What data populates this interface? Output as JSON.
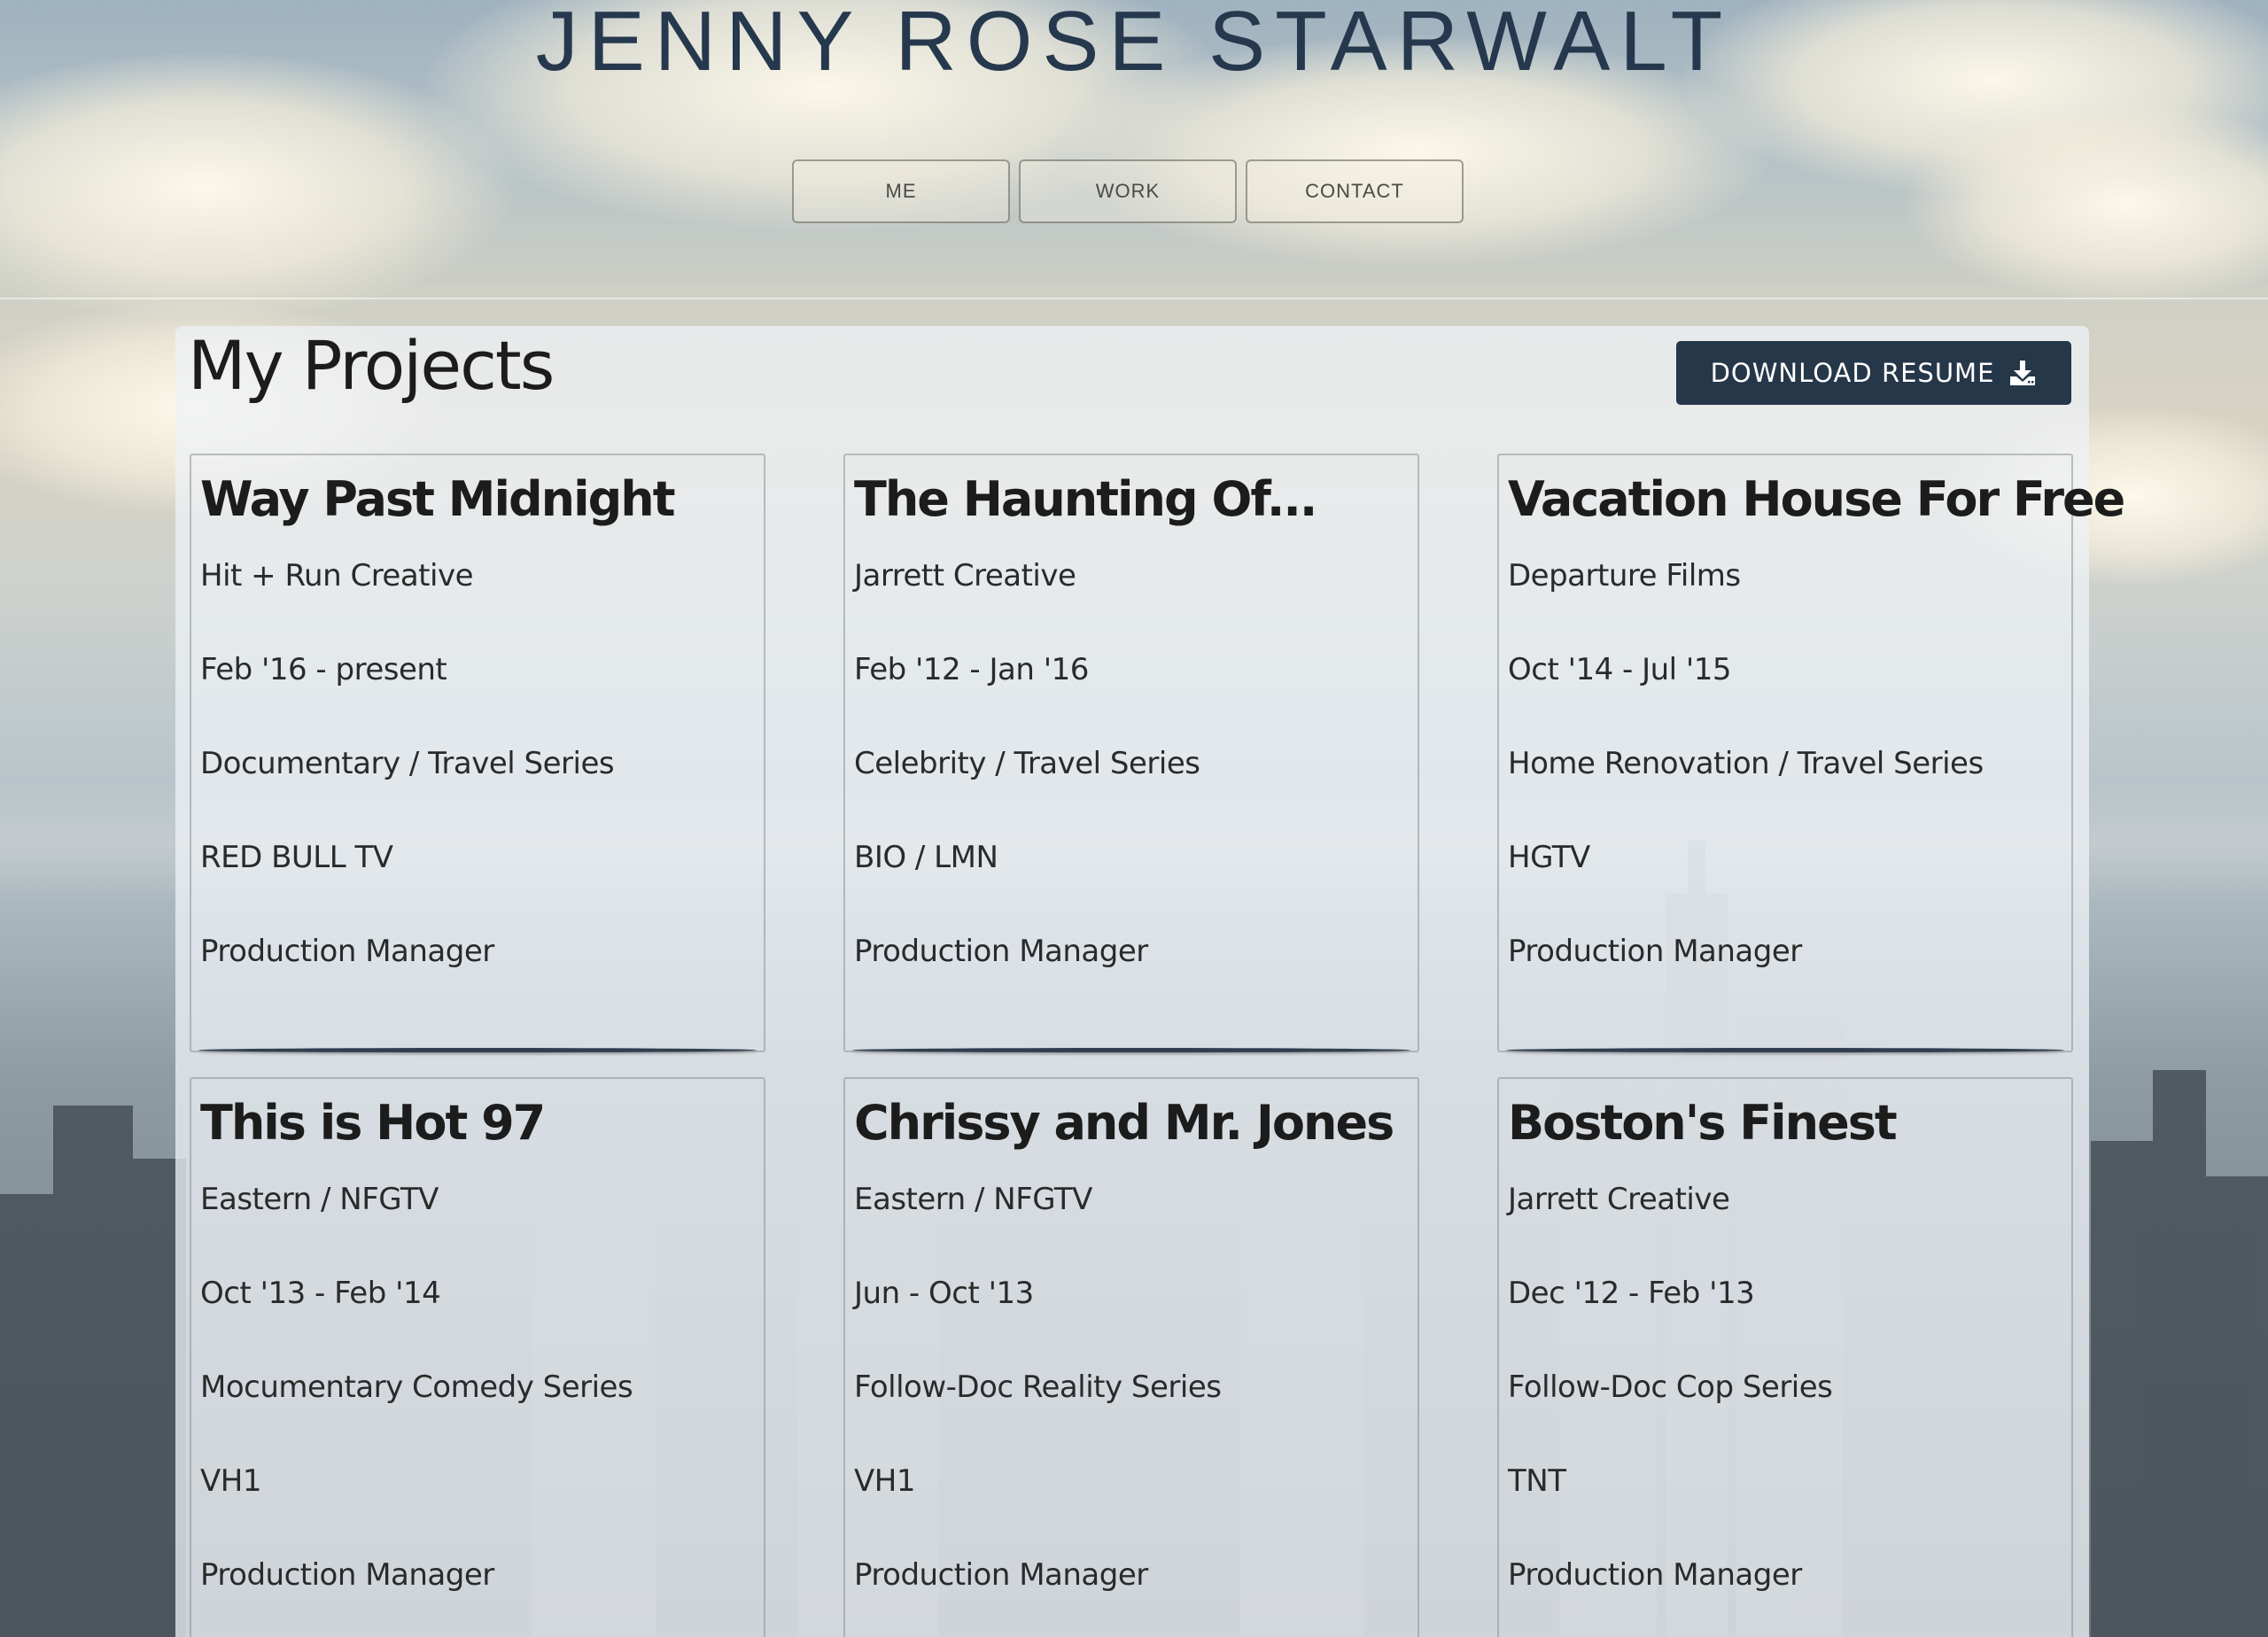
{
  "header": {
    "title": "JENNY ROSE STARWALT"
  },
  "nav": {
    "items": [
      {
        "label": "ME"
      },
      {
        "label": "WORK"
      },
      {
        "label": "CONTACT"
      }
    ]
  },
  "main": {
    "heading": "My Projects",
    "download_label": "DOWNLOAD RESUME",
    "download_icon": "download-icon"
  },
  "projects": [
    {
      "title": "Way Past Midnight",
      "company": "Hit + Run Creative",
      "dates": "Feb '16 - present",
      "genre": "Documentary / Travel Series",
      "network": "RED BULL TV",
      "role": "Production Manager"
    },
    {
      "title": "The Haunting Of...",
      "company": "Jarrett Creative",
      "dates": "Feb '12 - Jan '16",
      "genre": "Celebrity / Travel Series",
      "network": "BIO / LMN",
      "role": "Production Manager"
    },
    {
      "title": "Vacation House For Free",
      "company": "Departure Films",
      "dates": "Oct '14 - Jul '15",
      "genre": "Home Renovation / Travel Series",
      "network": "HGTV",
      "role": "Production Manager"
    },
    {
      "title": "This is Hot 97",
      "company": "Eastern / NFGTV",
      "dates": "Oct '13 - Feb '14",
      "genre": "Mocumentary Comedy Series",
      "network": "VH1",
      "role": "Production Manager"
    },
    {
      "title": "Chrissy and Mr. Jones",
      "company": "Eastern / NFGTV",
      "dates": "Jun - Oct '13",
      "genre": "Follow-Doc Reality Series",
      "network": "VH1",
      "role": "Production Manager"
    },
    {
      "title": "Boston's Finest",
      "company": "Jarrett Creative",
      "dates": "Dec '12 - Feb '13",
      "genre": "Follow-Doc Cop Series",
      "network": "TNT",
      "role": "Production Manager"
    }
  ],
  "colors": {
    "title": "#26384d",
    "button_bg": "#263749",
    "panel": "#eef2f6"
  }
}
